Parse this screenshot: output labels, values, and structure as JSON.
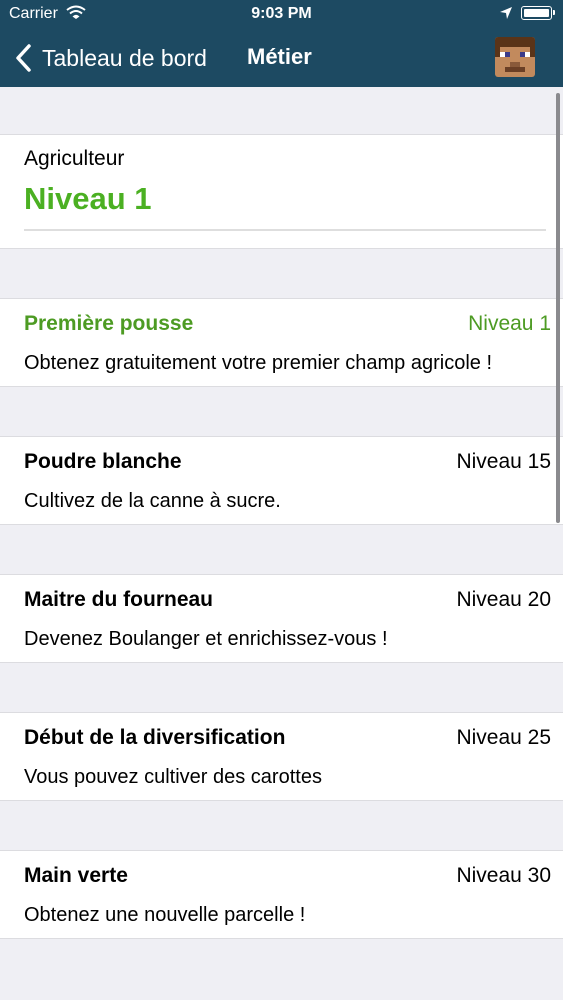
{
  "status_bar": {
    "carrier": "Carrier",
    "time": "9:03 PM"
  },
  "nav": {
    "back_label": "Tableau de bord",
    "title": "Métier"
  },
  "job": {
    "name": "Agriculteur",
    "level_label": "Niveau 1",
    "progress_fraction": 0
  },
  "unlocks": [
    {
      "title": "Première pousse",
      "level": "Niveau 1",
      "description": "Obtenez gratuitement votre premier champ agricole !",
      "active": true
    },
    {
      "title": "Poudre blanche",
      "level": "Niveau 15",
      "description": "Cultivez de la canne à sucre.",
      "active": false
    },
    {
      "title": "Maitre du fourneau",
      "level": "Niveau 20",
      "description": "Devenez Boulanger et enrichissez-vous !",
      "active": false
    },
    {
      "title": "Début de la diversification",
      "level": "Niveau 25",
      "description": "Vous pouvez cultiver des carottes",
      "active": false
    },
    {
      "title": "Main verte",
      "level": "Niveau 30",
      "description": "Obtenez une nouvelle parcelle !",
      "active": false
    }
  ],
  "colors": {
    "nav_background": "#1d4a62",
    "accent_green": "#4bb022",
    "active_green": "#4d9b23",
    "page_background": "#efeff4"
  }
}
